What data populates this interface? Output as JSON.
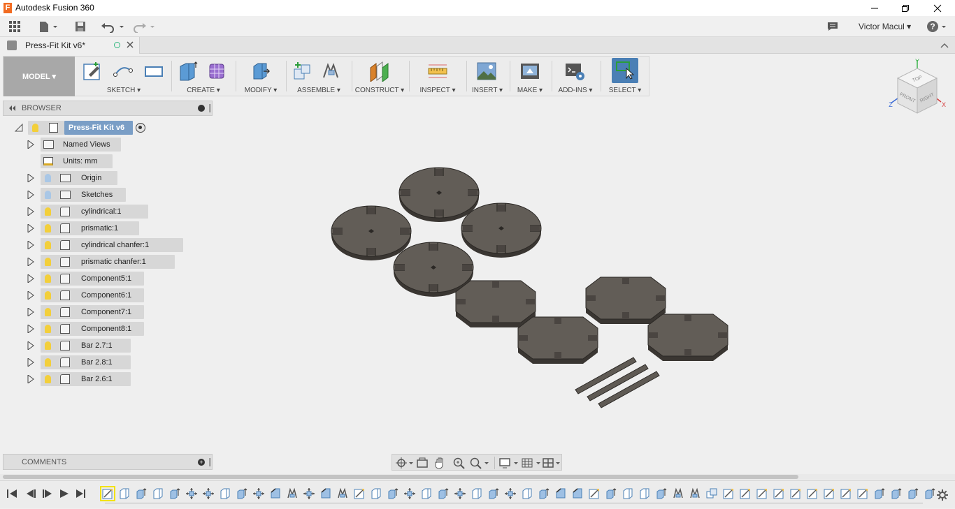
{
  "window": {
    "title": "Autodesk Fusion 360"
  },
  "header": {
    "user_name": "Victor Macul"
  },
  "document": {
    "tab_title": "Press-Fit Kit v6*"
  },
  "toolbar": {
    "workspace": "MODEL ▾",
    "groups": [
      {
        "label": "SKETCH ▾"
      },
      {
        "label": "CREATE ▾"
      },
      {
        "label": "MODIFY ▾"
      },
      {
        "label": "ASSEMBLE ▾"
      },
      {
        "label": "CONSTRUCT ▾"
      },
      {
        "label": "INSPECT ▾"
      },
      {
        "label": "INSERT ▾"
      },
      {
        "label": "MAKE ▾"
      },
      {
        "label": "ADD-INS ▾"
      },
      {
        "label": "SELECT ▾"
      }
    ]
  },
  "viewcube": {
    "top": "TOP",
    "front": "FRONT",
    "right": "RIGHT",
    "x": "X",
    "y": "Y",
    "z": "Z"
  },
  "browser": {
    "title": "BROWSER",
    "root": "Press-Fit Kit v6",
    "items": [
      {
        "label": "Named Views"
      },
      {
        "label": "Units: mm"
      },
      {
        "label": "Origin"
      },
      {
        "label": "Sketches"
      },
      {
        "label": "cylindrical:1"
      },
      {
        "label": "prismatic:1"
      },
      {
        "label": "cylindrical chanfer:1"
      },
      {
        "label": "prismatic chanfer:1"
      },
      {
        "label": "Component5:1"
      },
      {
        "label": "Component6:1"
      },
      {
        "label": "Component7:1"
      },
      {
        "label": "Component8:1"
      },
      {
        "label": "Bar 2.7:1"
      },
      {
        "label": "Bar 2.8:1"
      },
      {
        "label": "Bar 2.6:1"
      }
    ]
  },
  "comments": {
    "title": "COMMENTS"
  },
  "colors": {
    "accent": "#4a7fb5",
    "part": "#5f5a54",
    "part_edge": "#2e2b28",
    "light_bulb": "#f3cf3a"
  }
}
